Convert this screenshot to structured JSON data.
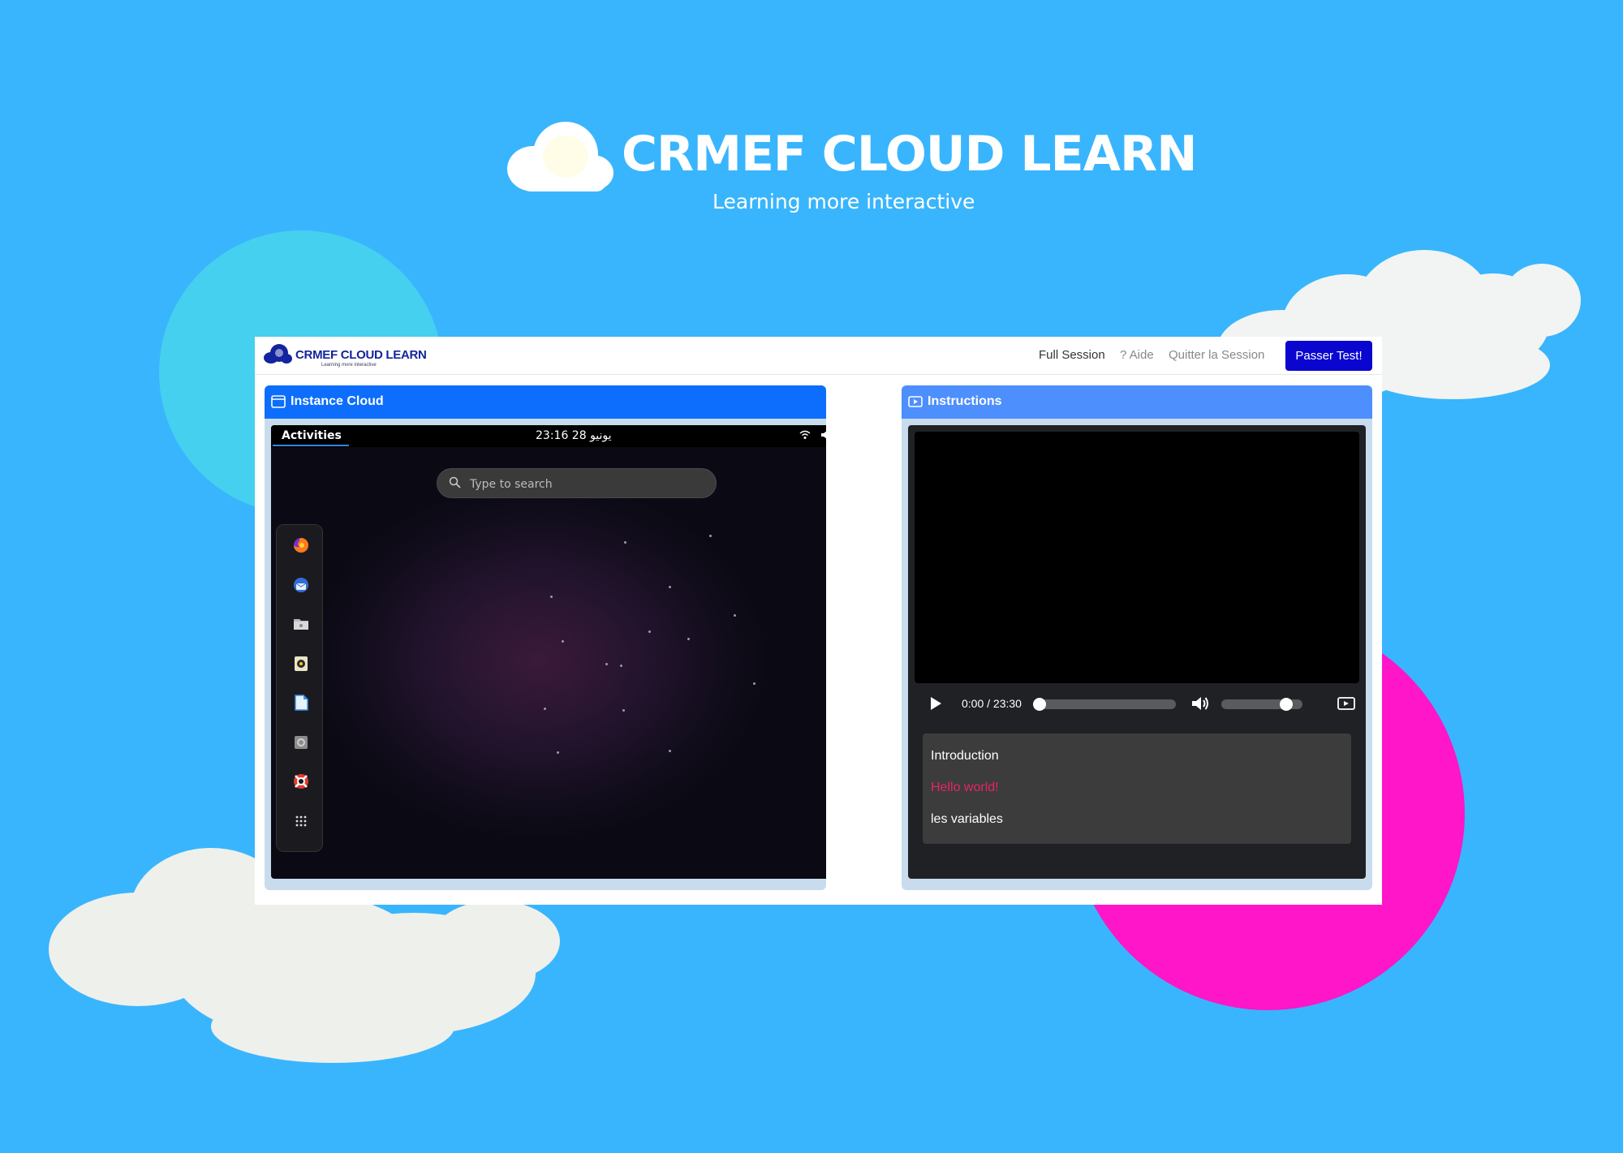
{
  "hero": {
    "title": "CRMEF CLOUD LEARN",
    "subtitle": "Learning more interactive"
  },
  "app": {
    "brand": {
      "name": "CRMEF CLOUD LEARN",
      "tagline": "Learning more interactive"
    },
    "nav": {
      "full_session": "Full Session",
      "aide": "? Aide",
      "quit": "Quitter la Session",
      "test_button": "Passer Test!"
    },
    "colors": {
      "primary": "#0d6efd",
      "button": "#0a06cf",
      "active_chapter": "#e6246a"
    }
  },
  "instance_panel": {
    "title": "Instance Cloud",
    "icon": "window-icon",
    "desktop": {
      "activities": "Activities",
      "clock": "23:16 28 يونيو",
      "search_placeholder": "Type to search",
      "tray_icons": [
        "wifi-icon",
        "volume-icon",
        "battery-icon",
        "dropdown-icon"
      ],
      "dock": [
        "firefox-icon",
        "thunderbird-icon",
        "files-icon",
        "rhythmbox-icon",
        "writer-icon",
        "settings-icon",
        "help-icon",
        "app-grid-icon"
      ]
    }
  },
  "instructions_panel": {
    "title": "Instructions",
    "icon": "video-icon",
    "player": {
      "time": "0:00 / 23:30",
      "progress": 0,
      "volume": 1.0
    },
    "chapters": [
      {
        "label": "Introduction",
        "active": false
      },
      {
        "label": "Hello world!",
        "active": true
      },
      {
        "label": "les variables",
        "active": false
      }
    ]
  }
}
